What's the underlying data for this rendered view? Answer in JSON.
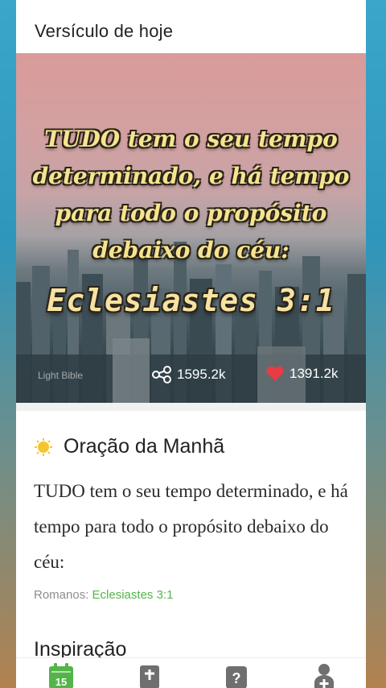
{
  "header": {
    "title": "Versículo de hoje"
  },
  "verse_card": {
    "verse_text": "TUDO tem o seu tempo determinado, e há tempo para todo o propósito debaixo do céu:",
    "reference": "Eclesiastes 3:1",
    "watermark": "Light Bible",
    "share_count": "1595.2k",
    "like_count": "1391.2k"
  },
  "prayer": {
    "title": "Oração da Manhã",
    "text": "TUDO tem o seu tempo determinado, e há tempo para todo o propósito debaixo do céu:",
    "source_label": "Romanos:",
    "source_ref": "Eclesiastes 3:1"
  },
  "inspiration": {
    "title": "Inspiração"
  },
  "tabbar": {
    "calendar_day": "15",
    "colors": {
      "active": "#53b548",
      "inactive": "#6f6f6f"
    },
    "tabs": [
      {
        "icon": "calendar-icon"
      },
      {
        "icon": "bible-icon"
      },
      {
        "icon": "question-icon"
      },
      {
        "icon": "profile-add-icon"
      }
    ]
  }
}
